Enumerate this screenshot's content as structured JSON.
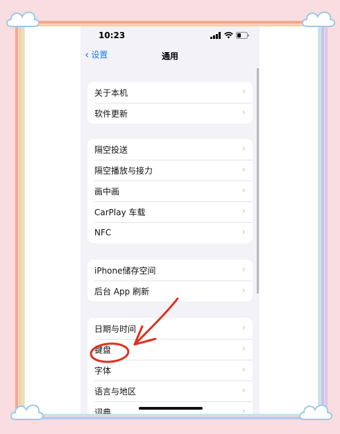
{
  "status_bar": {
    "time": "10:23"
  },
  "nav": {
    "back_label": "设置",
    "title": "通用"
  },
  "groups": [
    {
      "items": [
        {
          "label": "关于本机"
        },
        {
          "label": "软件更新"
        }
      ]
    },
    {
      "items": [
        {
          "label": "隔空投送"
        },
        {
          "label": "隔空播放与接力"
        },
        {
          "label": "画中画"
        },
        {
          "label": "CarPlay 车载"
        },
        {
          "label": "NFC"
        }
      ]
    },
    {
      "items": [
        {
          "label": "iPhone储存空间"
        },
        {
          "label": "后台 App 刷新"
        }
      ]
    },
    {
      "items": [
        {
          "label": "日期与时间"
        },
        {
          "label": "键盘"
        },
        {
          "label": "字体"
        },
        {
          "label": "语言与地区"
        },
        {
          "label": "词典"
        }
      ]
    }
  ],
  "icons": {
    "back": "chevron-left-icon",
    "row": "chevron-right-icon",
    "signal": "cellular-signal-icon",
    "wifi": "wifi-icon",
    "battery": "battery-icon"
  },
  "colors": {
    "accent": "#1a7cf5",
    "annotation": "#e0301e",
    "background": "#f2f2f7"
  }
}
